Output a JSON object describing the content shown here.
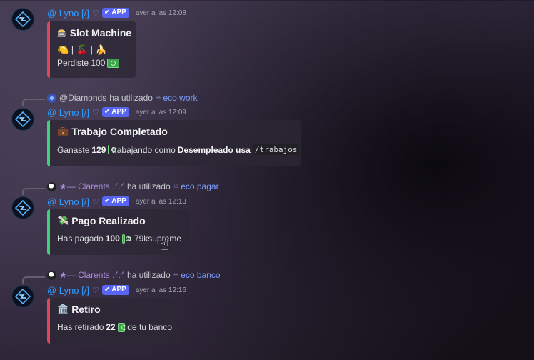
{
  "bot": {
    "name": "@ Lyno [/]",
    "heart": "♡",
    "badge": "APP"
  },
  "messages": [
    {
      "time": "ayer a las 12:08",
      "embed": {
        "icon": "🎰",
        "title": "Slot Machine",
        "slots": "🍋 | 🍒 | 🍌",
        "desc": "Perdiste 100"
      }
    },
    {
      "reply": {
        "user": "@Diamonds",
        "used": "ha utilizado",
        "command": "eco work"
      },
      "time": "ayer a las 12:09",
      "embed": {
        "icon": "💼",
        "title": "Trabajo Completado",
        "desc_pre": "Ganaste",
        "amount": "129",
        "desc_mid": "trabajando como",
        "job": "Desempleado usa",
        "code": "/trabajos"
      }
    },
    {
      "reply": {
        "user": "★— Clarents .ᐟ.ᐟ",
        "used": "ha utilizado",
        "command": "eco pagar"
      },
      "time": "ayer a las 12:13",
      "embed": {
        "icon": "💸",
        "title": "Pago Realizado",
        "desc_pre": "Has pagado",
        "amount": "100",
        "desc_post": "a 79ksupreme"
      }
    },
    {
      "reply": {
        "user": "★— Clarents .ᐟ.ᐟ",
        "used": "ha utilizado",
        "command": "eco banco"
      },
      "time": "ayer a las 12:16",
      "embed": {
        "icon": "🏛️",
        "title": "Retiro",
        "desc_pre": "Has retirado",
        "amount": "22",
        "desc_post": "de tu banco"
      }
    }
  ],
  "colors": {
    "red_accent": "#e0465a",
    "green_accent": "#3fd07a",
    "bot_name": "#2f9bff",
    "app_badge": "#5865f2"
  }
}
